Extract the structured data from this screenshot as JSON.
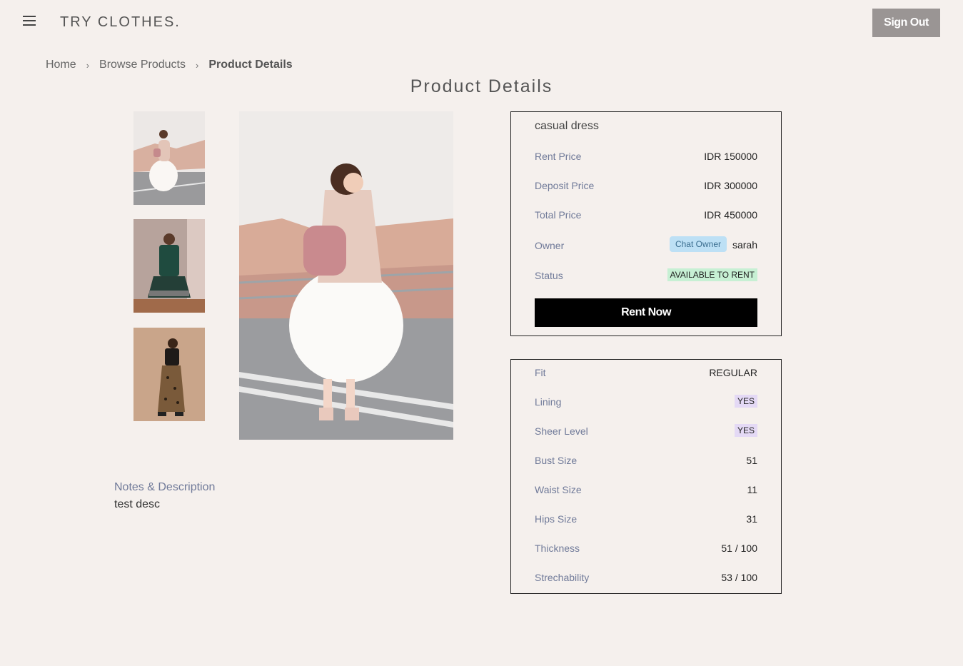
{
  "header": {
    "brand": "TRY CLOTHES.",
    "signout_label": "Sign Out"
  },
  "breadcrumb": {
    "home": "Home",
    "browse": "Browse Products",
    "current": "Product Details",
    "separator": "›"
  },
  "page_title": "Product Details",
  "product": {
    "name": "casual dress",
    "rent_price_label": "Rent Price",
    "rent_price": "IDR 150000",
    "deposit_price_label": "Deposit Price",
    "deposit_price": "IDR 300000",
    "total_price_label": "Total Price",
    "total_price": "IDR 450000",
    "owner_label": "Owner",
    "chat_owner_label": "Chat Owner",
    "owner_name": "sarah",
    "status_label": "Status",
    "status": "AVAILABLE TO RENT",
    "rent_now_label": "Rent Now"
  },
  "specs": {
    "fit_label": "Fit",
    "fit": "REGULAR",
    "lining_label": "Lining",
    "lining": "YES",
    "sheer_label": "Sheer Level",
    "sheer": "YES",
    "bust_label": "Bust Size",
    "bust": "51",
    "waist_label": "Waist Size",
    "waist": "11",
    "hips_label": "Hips Size",
    "hips": "31",
    "thickness_label": "Thickness",
    "thickness": "51 / 100",
    "stretch_label": "Strechability",
    "stretch": "53 / 100"
  },
  "notes": {
    "label": "Notes & Description",
    "text": "test desc"
  },
  "colors": {
    "background": "#f5f0ed",
    "signout_bg": "#9a9594",
    "rent_btn": "#000000",
    "label": "#707a99",
    "status_green": "#c7f0d4",
    "chat_blue": "#bde0f5",
    "badge_purple": "#e4d9f5"
  },
  "icons": {
    "menu": "hamburger-menu-icon"
  }
}
